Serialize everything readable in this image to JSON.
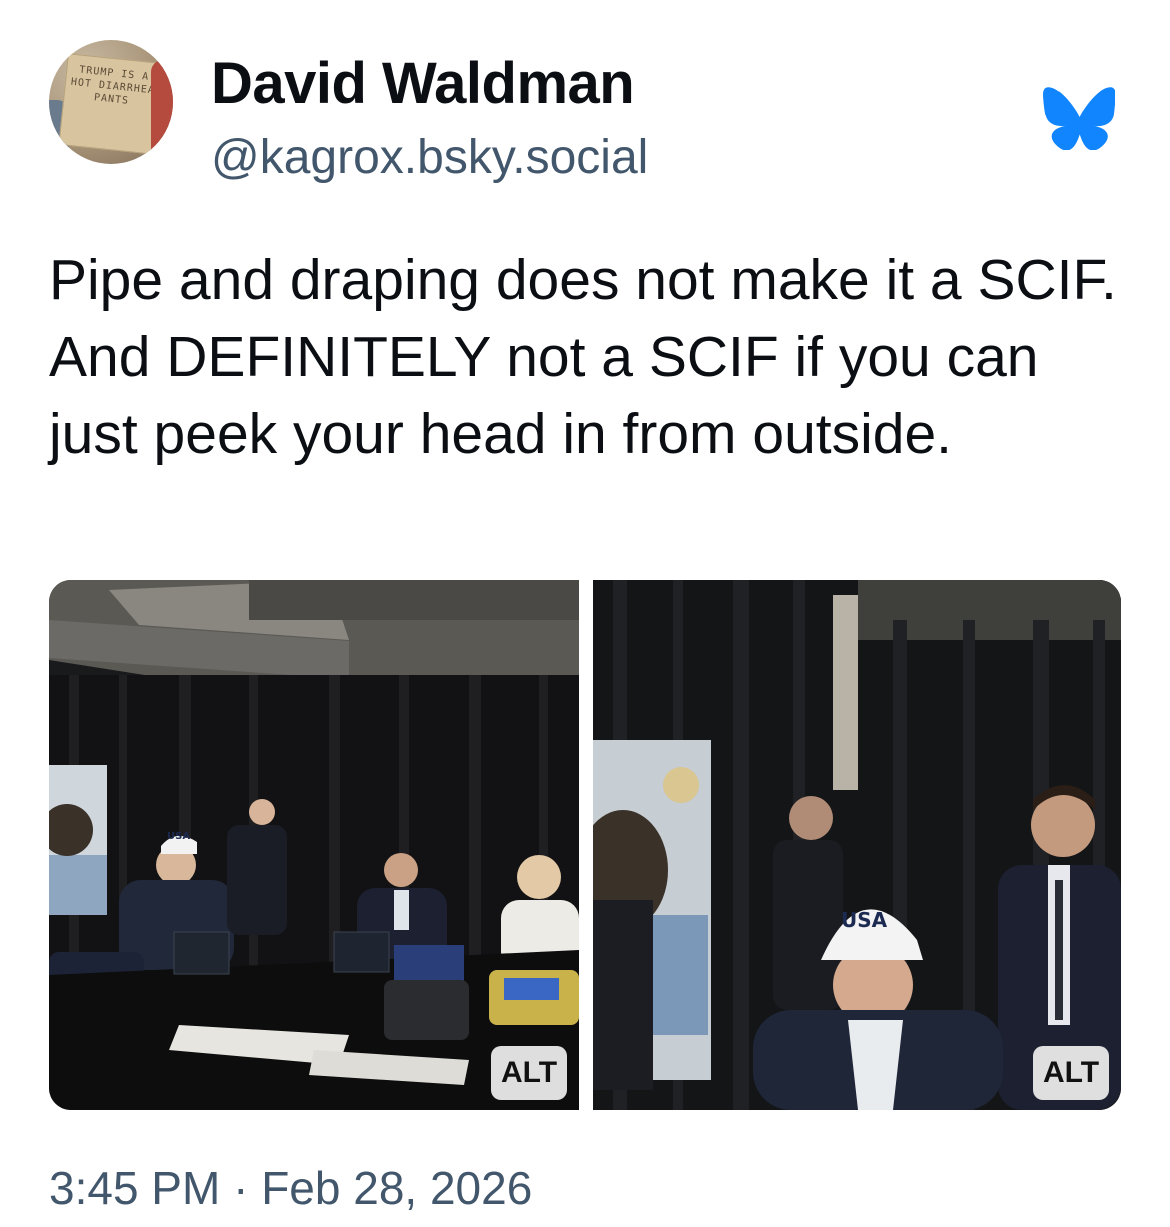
{
  "author": {
    "display_name": "David Waldman",
    "handle": "@kagrox.bsky.social",
    "avatar_sign_text": "TRUMP IS A HOT DIARRHEA PANTS"
  },
  "post": {
    "text": "Pipe and draping does not make it a SCIF. And DEFINITELY not a SCIF if you can just peek your head in from outside."
  },
  "media": [
    {
      "alt_label": "ALT",
      "cap_text": "USA"
    },
    {
      "alt_label": "ALT",
      "cap_text": "USA"
    }
  ],
  "timestamp": "3:45 PM · Feb 28, 2026",
  "colors": {
    "bluesky_blue": "#1185fe",
    "text_primary": "#0b0f14",
    "text_secondary": "#42576c"
  },
  "icons": {
    "platform": "bluesky-butterfly-icon"
  }
}
